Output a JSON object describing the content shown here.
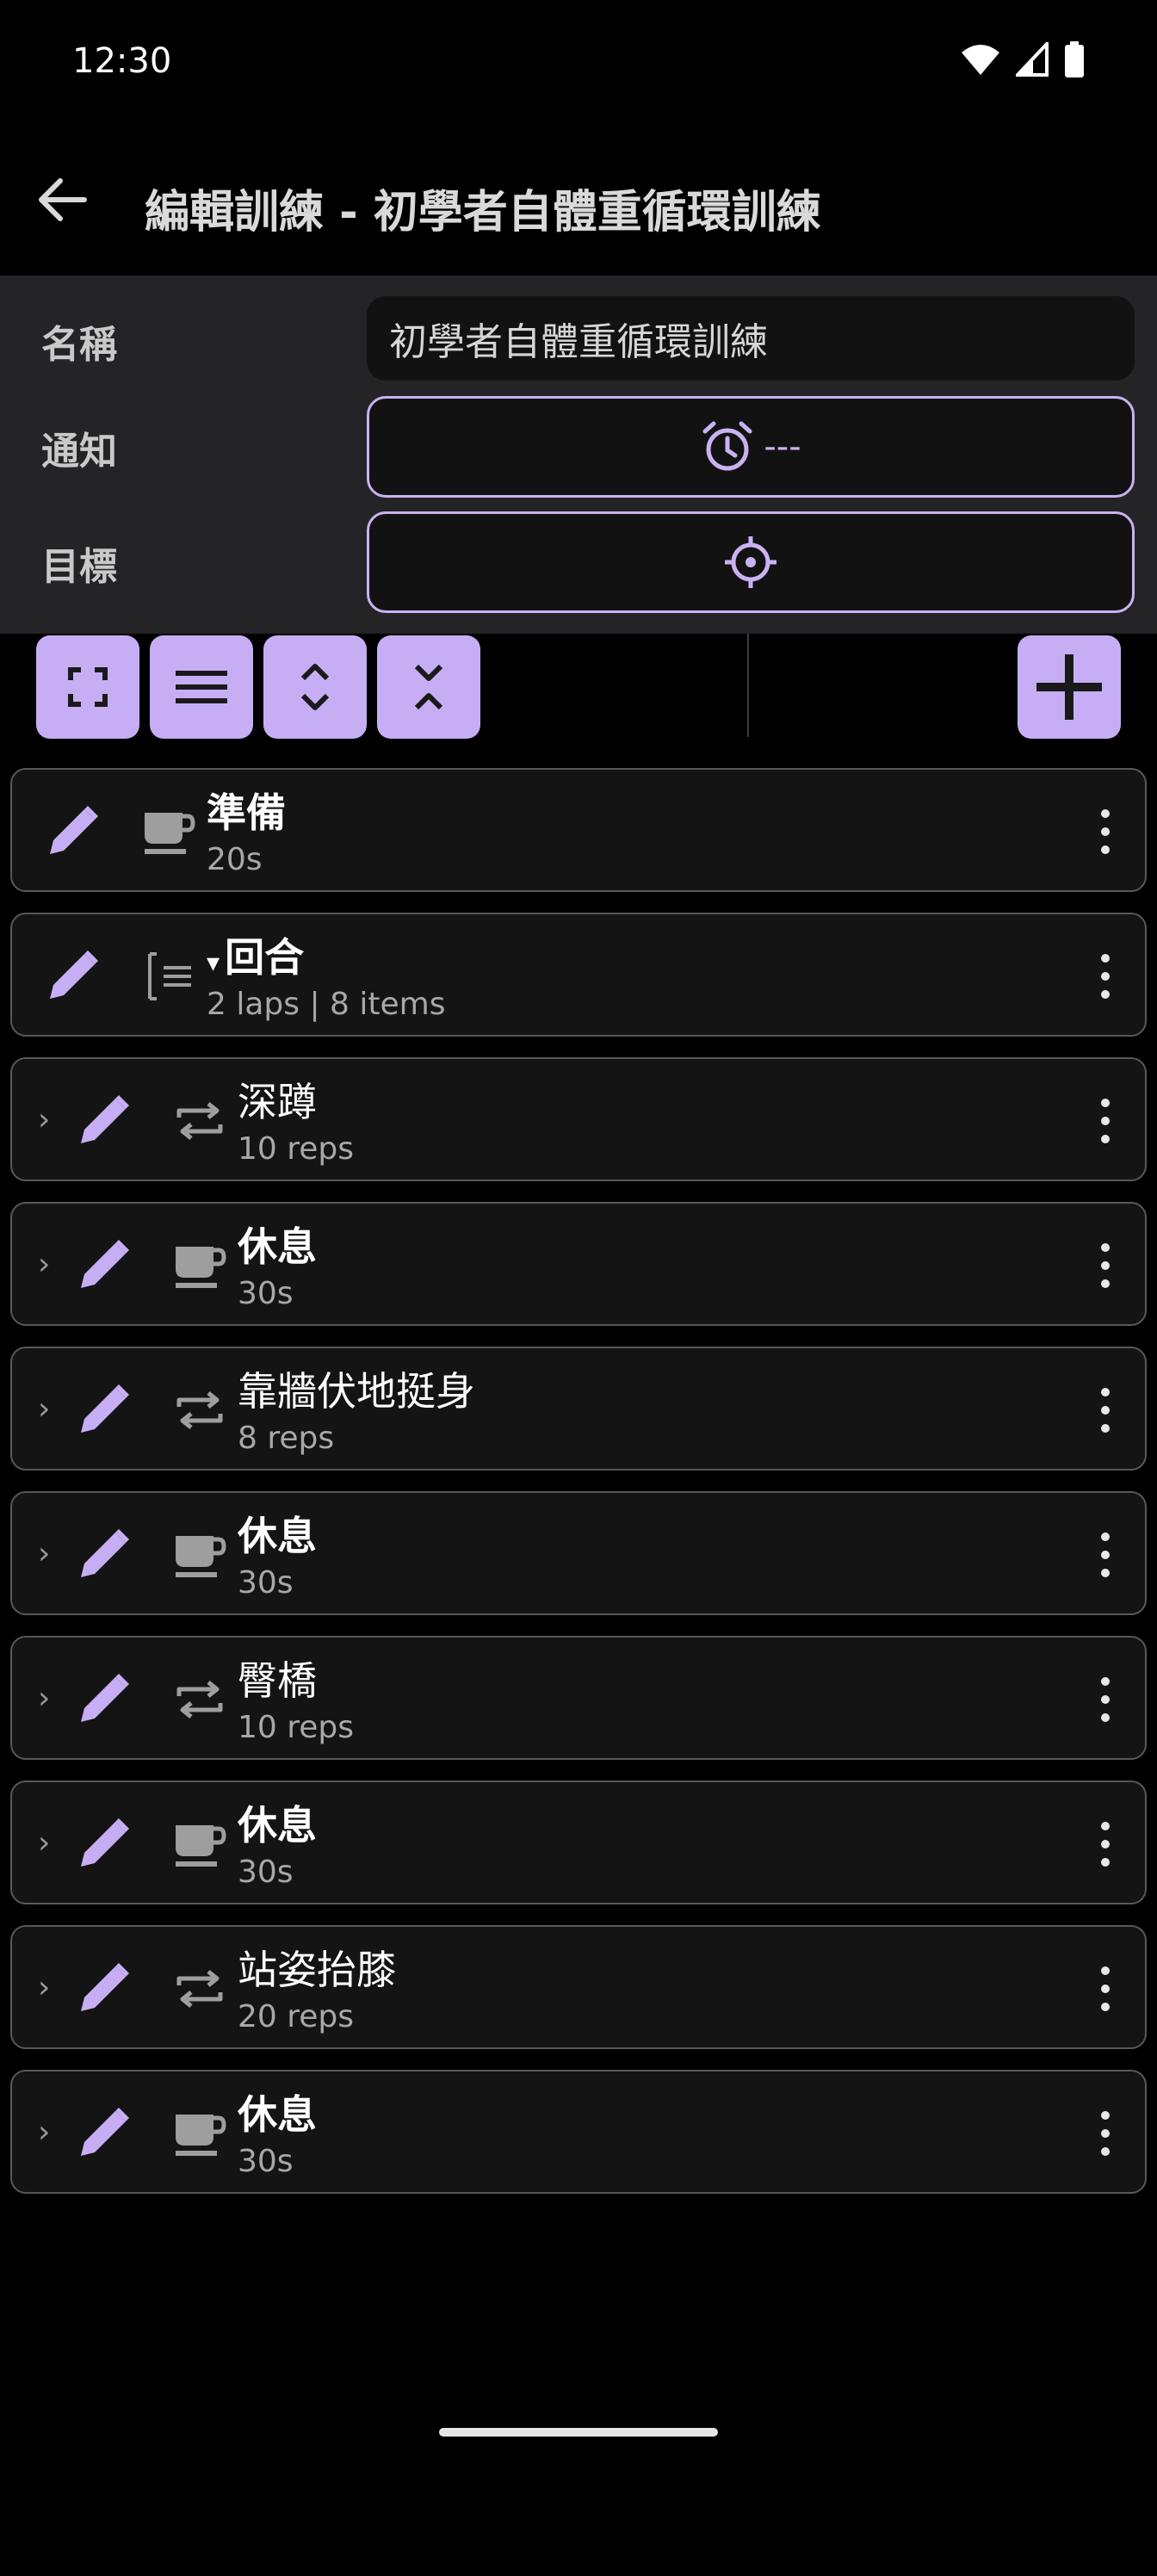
{
  "status": {
    "time": "12:30"
  },
  "appbar": {
    "title": "編輯訓練 - 初學者自體重循環訓練"
  },
  "form": {
    "name_label": "名稱",
    "name_value": "初學者自體重循環訓練",
    "notify_label": "通知",
    "notify_value": "---",
    "goal_label": "目標"
  },
  "colors": {
    "accent": "#c7aef4",
    "panel": "#242426",
    "row_bg": "#141414",
    "border": "#585858"
  },
  "items": [
    {
      "title": "準備",
      "sub": "20s",
      "type": "rest",
      "bold": true
    },
    {
      "title": "回合",
      "sub": "2 laps | 8 items",
      "type": "round",
      "bold": true
    },
    {
      "title": "深蹲",
      "sub": "10 reps",
      "type": "reps",
      "bold": false
    },
    {
      "title": "休息",
      "sub": "30s",
      "type": "rest",
      "bold": true
    },
    {
      "title": "靠牆伏地挺身",
      "sub": "8 reps",
      "type": "reps",
      "bold": false
    },
    {
      "title": "休息",
      "sub": "30s",
      "type": "rest",
      "bold": true
    },
    {
      "title": "臀橋",
      "sub": "10 reps",
      "type": "reps",
      "bold": false
    },
    {
      "title": "休息",
      "sub": "30s",
      "type": "rest",
      "bold": true
    },
    {
      "title": "站姿抬膝",
      "sub": "20 reps",
      "type": "reps",
      "bold": false
    },
    {
      "title": "休息",
      "sub": "30s",
      "type": "rest",
      "bold": true
    }
  ]
}
